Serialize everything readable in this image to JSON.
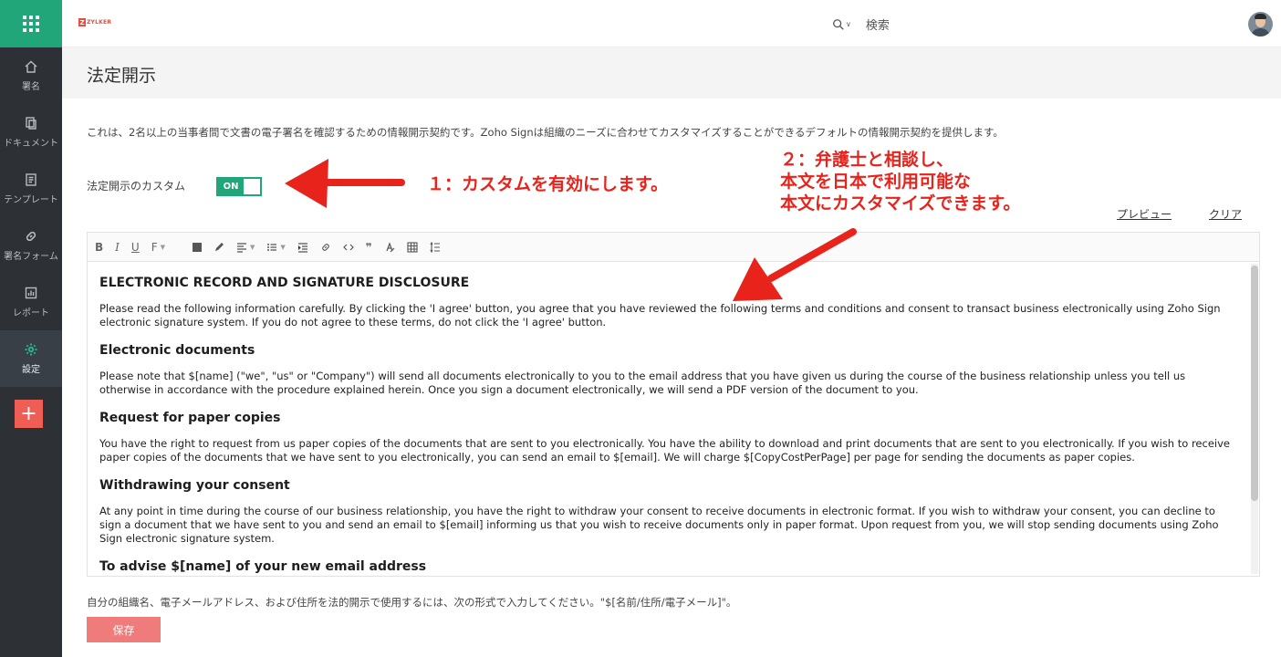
{
  "sidebar": {
    "items": [
      {
        "label": "署名",
        "icon": "home-icon"
      },
      {
        "label": "ドキュメント",
        "icon": "document-icon"
      },
      {
        "label": "テンプレート",
        "icon": "template-icon"
      },
      {
        "label": "署名フォーム",
        "icon": "link-icon"
      },
      {
        "label": "レポート",
        "icon": "report-icon"
      },
      {
        "label": "設定",
        "icon": "gear-icon"
      }
    ],
    "add_label": "+"
  },
  "topbar": {
    "logo_text": "ZYLKER",
    "search_label": "検索"
  },
  "page": {
    "title": "法定開示",
    "intro": "これは、2名以上の当事者間で文書の電子署名を確認するための情報開示契約です。Zoho Signは組織のニーズに合わせてカスタマイズすることができるデフォルトの情報開示契約を提供します。",
    "custom_label": "法定開示のカスタム",
    "toggle_label": "ON",
    "preview_link": "プレビュー",
    "clear_link": "クリア",
    "footer_note": "自分の組織名、電子メールアドレス、および住所を法的開示で使用するには、次の形式で入力してください。\"$[名前/住所/電子メール]\"。",
    "save_label": "保存"
  },
  "annotations": {
    "a1": "１：カスタムを有効にします。",
    "a2_line1": "２：弁護士と相談し、",
    "a2_line2": "本文を日本で利用可能な",
    "a2_line3": "本文にカスタマイズできます。",
    "color": "#e8231b"
  },
  "editor": {
    "toolbar": {
      "bold": "B",
      "italic": "I",
      "underline": "U",
      "font": "F",
      "quote": "❞"
    },
    "content": {
      "h1": "ELECTRONIC RECORD AND SIGNATURE DISCLOSURE",
      "p1": "Please read the following information carefully. By clicking the 'I agree' button, you agree that you have reviewed the following terms and conditions and consent to transact business electronically using Zoho Sign electronic signature system. If you do not agree to these terms, do not click the 'I agree' button.",
      "h2": "Electronic documents",
      "p2": "Please note that $[name] (\"we\", \"us\" or \"Company\") will send all documents electronically to you to the email address that you have given us during the course of the business relationship unless you tell us otherwise in accordance with the procedure explained herein. Once you sign a document electronically, we will send a PDF version of the document to you.",
      "h3": "Request for paper copies",
      "p3": "You have the right to request from us paper copies of the documents that are sent to you electronically. You have the ability to download and print documents that are sent to you electronically. If you wish to receive paper copies of the documents that we have sent to you electronically, you can send an email to $[email]. We will charge $[CopyCostPerPage] per page for sending the documents as paper copies.",
      "h4": "Withdrawing your consent",
      "p4": "At any point in time during the course of our business relationship, you have the right to withdraw your consent to receive documents in electronic format. If you wish to withdraw your consent, you can decline to sign a document that we have sent to you and send an email to $[email] informing us that you wish to receive documents only in paper format. Upon request from you, we will stop sending documents using Zoho Sign electronic signature system.",
      "h5": "To advise $[name] of your new email address"
    }
  },
  "colors": {
    "sidebar_bg": "#2d3136",
    "brand_green": "#21a67a",
    "add_red": "#ef5e55",
    "save_button": "#f07b7b"
  }
}
